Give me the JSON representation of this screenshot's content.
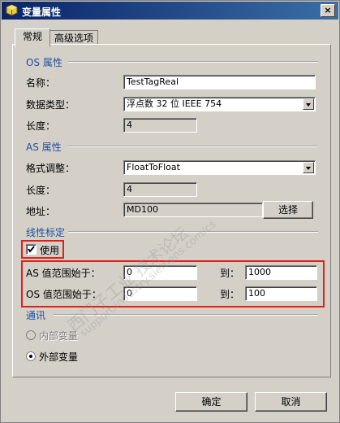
{
  "window": {
    "title": "变量属性",
    "close_glyph": "×"
  },
  "tabs": [
    {
      "label": "常规",
      "active": true
    },
    {
      "label": "高级选项",
      "active": false
    }
  ],
  "os_section": {
    "title": "OS 属性",
    "name_label": "名称：",
    "name_value": "TestTagReal",
    "datatype_label": "数据类型：",
    "datatype_value": "浮点数 32 位 IEEE 754",
    "length_label": "长度：",
    "length_value": "4"
  },
  "as_section": {
    "title": "AS 属性",
    "format_label": "格式调整：",
    "format_value": "FloatToFloat",
    "length_label": "长度：",
    "length_value": "4",
    "address_label": "地址：",
    "address_value": "MD100",
    "select_button": "选择"
  },
  "linear": {
    "title": "线性标定",
    "use_label": "使用",
    "use_checked": true,
    "as_range_label": "AS 值范围始于：",
    "as_from": "0",
    "as_to_label": "到：",
    "as_to": "1000",
    "os_range_label": "OS 值范围始于：",
    "os_from": "0",
    "os_to_label": "到：",
    "os_to": "100"
  },
  "comm": {
    "title": "通讯",
    "internal_label": "内部变量",
    "external_label": "外部变量",
    "selected": "external"
  },
  "footer": {
    "ok_button": "确定",
    "cancel_button": "取消"
  },
  "watermark": {
    "text": "西门子工业 技术论坛",
    "url": "support.industry.siemens.com/cs"
  },
  "colors": {
    "section_title": "#1f4e9e",
    "highlight_box": "#e0201a",
    "titlebar": "#0a246a"
  }
}
